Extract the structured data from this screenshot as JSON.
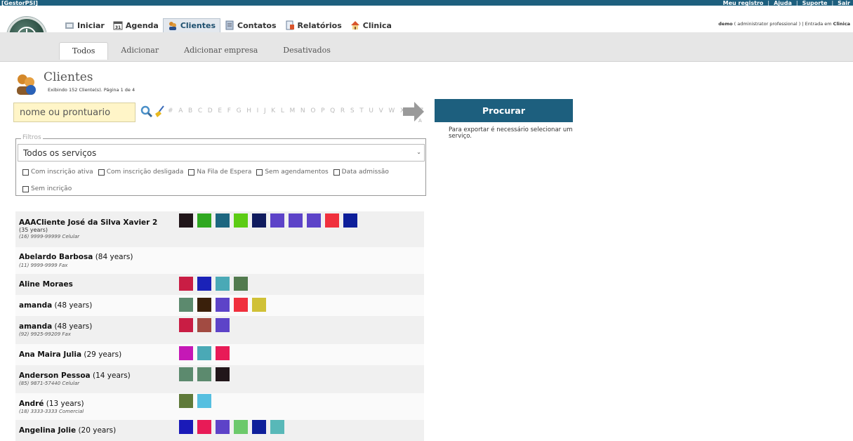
{
  "app": {
    "brand": "[GestorPSI]"
  },
  "top_links": [
    "Meu registro",
    "|",
    "Ajuda",
    "|",
    "Suporte",
    "|",
    "Sair"
  ],
  "user_meta": {
    "user": "demo",
    "role": "( administrator professional )",
    "sep": "|",
    "entry": "Entrada em",
    "clinic": "Clinica"
  },
  "nav": [
    {
      "label": "Iniciar",
      "icon": "home-icon",
      "active": false
    },
    {
      "label": "Agenda",
      "icon": "calendar-icon",
      "active": false
    },
    {
      "label": "Clientes",
      "icon": "clients-icon",
      "active": true
    },
    {
      "label": "Contatos",
      "icon": "contacts-icon",
      "active": false
    },
    {
      "label": "Relatórios",
      "icon": "reports-icon",
      "active": false
    },
    {
      "label": "Clinica",
      "icon": "house-icon",
      "active": false
    }
  ],
  "subtabs": [
    "Todos",
    "Adicionar",
    "Adicionar empresa",
    "Desativados"
  ],
  "page": {
    "title": "Clientes",
    "subtitle": "Exibindo 152 Cliente(s). Página 1 de 4"
  },
  "search": {
    "placeholder": "nome ou prontuario",
    "alphabet": "# A B C D E F G H I J K L M N O P Q R S T U V W X Y Z",
    "arrow_label": "A",
    "button": "Procurar"
  },
  "export_note": "Para exportar é necessário selecionar um serviço.",
  "filters": {
    "legend": "Filtros",
    "service_selected": "Todos os serviços",
    "checkboxes": [
      "Com inscrição ativa",
      "Com inscrição desligada",
      "Na Fila de Espera",
      "Sem agendamentos",
      "Data admissão",
      "Sem incrição"
    ]
  },
  "clients": [
    {
      "name": "AAACliente José da Silva Xavier 2",
      "age": "",
      "detail": "(35 years)",
      "phone": "(16) 9999-99999 Celular",
      "colors": [
        "#21161a",
        "#2fa820",
        "#1d6680",
        "#5ccc14",
        "#101b5e",
        "#5d43c8",
        "#5d43c8",
        "#5d43c8",
        "#f0303d",
        "#0e1f9a"
      ]
    },
    {
      "name": "Abelardo Barbosa",
      "age": "(84 years)",
      "detail": "",
      "phone": "(11) 9999-9999 Fax",
      "colors": []
    },
    {
      "name": "Aline Moraes",
      "age": "",
      "detail": "",
      "phone": "",
      "colors": [
        "#c91d44",
        "#1a22b8",
        "#4aa9b6",
        "#527a4e"
      ]
    },
    {
      "name": "amanda",
      "age": "(48 years)",
      "detail": "",
      "phone": "",
      "colors": [
        "#5c8a6e",
        "#3a200b",
        "#5d43c8",
        "#f0303d",
        "#d0c137"
      ]
    },
    {
      "name": "amanda",
      "age": "(48 years)",
      "detail": "",
      "phone": "(92) 9925-99209 Fax",
      "colors": [
        "#c91d44",
        "#a24b42",
        "#5d43c8"
      ]
    },
    {
      "name": "Ana Maira Julia",
      "age": "(29 years)",
      "detail": "",
      "phone": "",
      "colors": [
        "#c518b6",
        "#4aa9b6",
        "#e81b57"
      ]
    },
    {
      "name": "Anderson Pessoa",
      "age": "(14 years)",
      "detail": "",
      "phone": "(85) 9871-57440 Celular",
      "colors": [
        "#5c8a6e",
        "#5c8a6e",
        "#21161a"
      ]
    },
    {
      "name": "André",
      "age": "(13 years)",
      "detail": "",
      "phone": "(18) 3333-3333 Comercial",
      "colors": [
        "#5f7a3a",
        "#56bfe0"
      ]
    },
    {
      "name": "Angelina Jolie",
      "age": "(20 years)",
      "detail": "",
      "phone": "",
      "colors": [
        "#1a1ab8",
        "#e81b57",
        "#5d43c8",
        "#6cc96b",
        "#0e1f9a",
        "#58b8b8"
      ]
    }
  ]
}
